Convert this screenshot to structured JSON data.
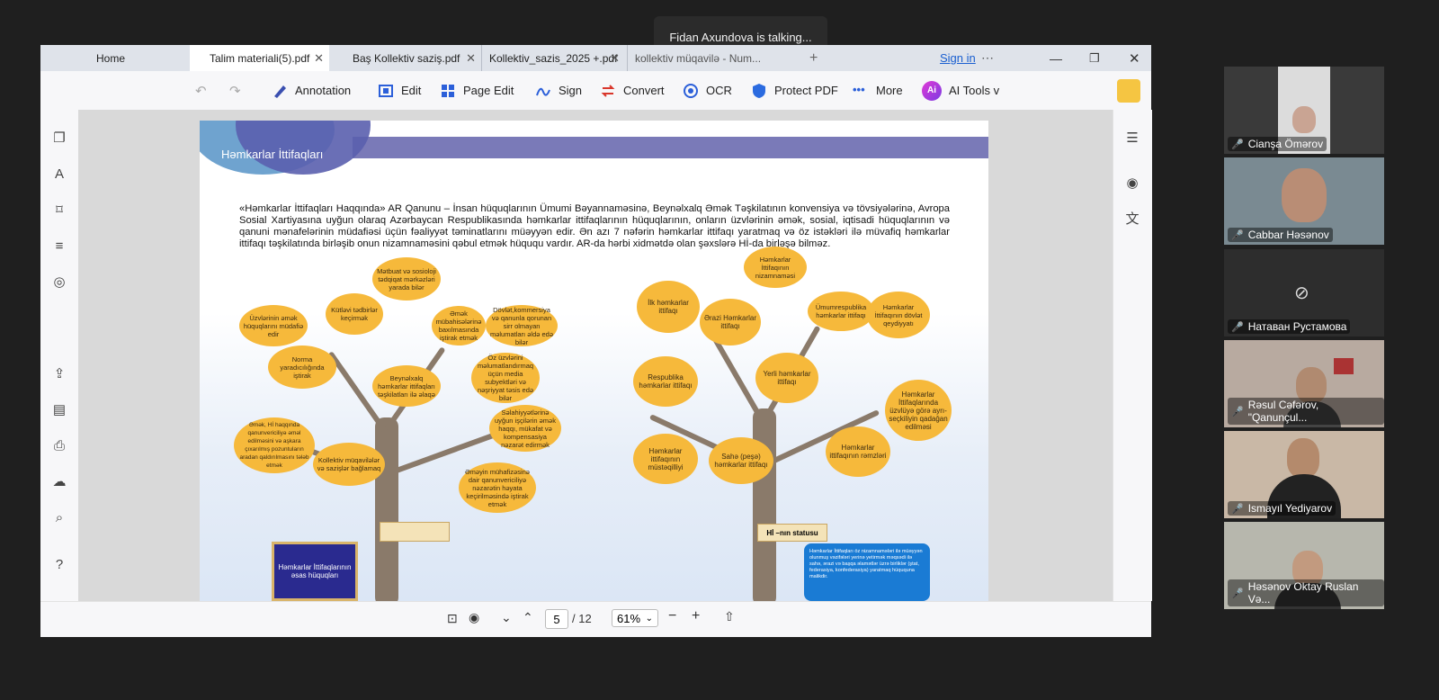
{
  "meeting": {
    "speaking_banner": "Fidan Axundova is talking..."
  },
  "pdf_app": {
    "tabs": [
      {
        "label": "Home",
        "active": false,
        "closable": false
      },
      {
        "label": "Talim materiali(5).pdf",
        "active": true,
        "closable": true
      },
      {
        "label": "Baş Kollektiv saziş.pdf",
        "active": false,
        "closable": true
      },
      {
        "label": "Kollektiv_sazis_2025 +.pdf",
        "active": false,
        "closable": true
      },
      {
        "label": "kollektiv müqavilə - Num...",
        "active": false,
        "closable": true
      }
    ],
    "sign_in": "Sign in",
    "toolbar": {
      "annotation": "Annotation",
      "edit": "Edit",
      "page_edit": "Page Edit",
      "sign": "Sign",
      "convert": "Convert",
      "ocr": "OCR",
      "protect": "Protect PDF",
      "more": "More",
      "ai_tools": "AI Tools v",
      "ai_badge": "Ai"
    },
    "bottom": {
      "current_page": "5",
      "total_pages": "/ 12",
      "zoom": "61%"
    },
    "document": {
      "heading": "Həmkarlar İttifaqları",
      "paragraph": "«Həmkarlar İttifaqları Haqqında» AR Qanunu – İnsan hüquqlarının Ümumi Bəyannaməsinə, Beynəlxalq Əmək Təşkilatının konvensiya və tövsiyələrinə, Avropa Sosial Xartiyasına uyğun olaraq Azərbaycan Respublikasında həmkarlar ittifaqlarının hüquqlarının, onların üzvlərinin əmək, sosial, iqtisadi hüquqlarının və qanuni mənafelərinin müdafiəsi üçün fəaliyyət təminatlarını müəyyən edir. Ən azı 7 nəfərin həmkarlar ittifaqı yaratmaq və öz istəkləri ilə müvafiq həmkarlar ittifaqı təşkilatında birləşib onun nizamnaməsini qəbul etmək hüququ vardır. AR-da hərbi xidmətdə olan şəxslərə Hİ-da birləşə bilməz.",
      "left_tree_leaves": [
        "Mətbuat və sosioloji tədqiqat mərkəzləri yarada bilər",
        "Üzvlərinin əmək hüquqlarını müdafiə edir",
        "Kütləvi tədbirlər keçirmək",
        "Əmək mübahisələrinə baxılmasında iştirak etmək",
        "Dövlət,kommersiya və qanunla qorunan sirr olmayan məlumatları əldə edə bilər",
        "Norma yaradıcılığında iştirak",
        "Beynəlxalq həmkarlar ittifaqları təşkilatları ilə əlaqə",
        "Öz üzvlərini məlumatlandırmaq üçün media subyektləri və nəşriyyat təsis edə bilər",
        "Səlahiyyətlərinə uyğun işçilərin əmək haqqı, mükafat və kompensasiya nəzarət edirmək",
        "Əmək, Hİ haqqında qanunvericiliyə əməl edilməsini və aşkara çıxarılmış pozuntuların aradan qaldırılmasını tələb etmək",
        "Kollektiv müqavilələr və sazişlər bağlamaq",
        "Əməyin mühafizəsinə dair qanunvericiliyə nəzarətin həyata keçirilməsində iştirak etmək"
      ],
      "left_sign": "Həmkarlar İttifaqlarının əsas hüquqları",
      "right_tree_leaves": [
        "Həmkarlar İttifaqının nizamnaməsi",
        "İlk həmkarlar ittifaqı",
        "Ərazi Həmkarlar ittifaqı",
        "Ümumrespublika həmkarlar ittifaqı",
        "Həmkarlar İttifaqının dövlət qeydiyyatı",
        "Respublika həmkarlar ittifaqı",
        "Yerli həmkarlar ittifaqı",
        "Həmkarlar İttifaqlarında üzvlüyə görə ayrı-seçkiliyin qadağan edilməsi",
        "Həmkarlar ittifaqının müstəqilliyi",
        "Sahə (peşə) həmkarlar ittifaqı",
        "Həmkarlar ittifaqının rəmzləri"
      ],
      "right_status_label": "Hİ –nın statusu",
      "right_sign_text": "Həmkarlar İttifaqları öz nizamnamələri ilə müəyyən olunmuş vəzifələri yerinə yetirmək məqsədi ilə sahə, ərazi və başqa əlamətlər üzrə birliklər (ştat, federasiya, konfederasiya) yaratmaq hüququna malikdir."
    }
  },
  "participants": [
    {
      "name": "Cianşa Ömərov",
      "muted": true
    },
    {
      "name": "Cabbar Həsənov",
      "muted": true
    },
    {
      "name": "Натаван Рустамова",
      "muted": true,
      "camera_off": true
    },
    {
      "name": "Rəsul Cəfərov, \"Qanunçul...",
      "muted": true
    },
    {
      "name": "Ismayıl Yediyarov",
      "muted": true
    },
    {
      "name": "Həsənov Oktay Ruslan Və...",
      "muted": true
    }
  ]
}
